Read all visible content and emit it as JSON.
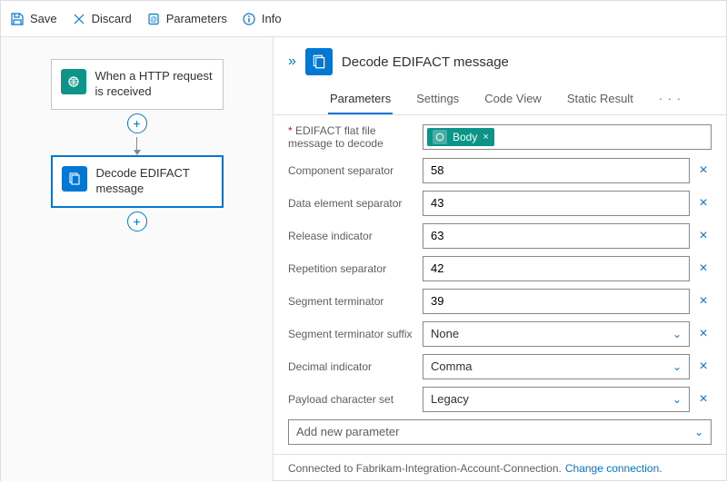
{
  "toolbar": {
    "save": "Save",
    "discard": "Discard",
    "parameters": "Parameters",
    "info": "Info"
  },
  "canvas": {
    "trigger": "When a HTTP request is received",
    "action": "Decode EDIFACT message"
  },
  "panel": {
    "title": "Decode EDIFACT message",
    "tabs": {
      "parameters": "Parameters",
      "settings": "Settings",
      "codeview": "Code View",
      "staticresult": "Static Result",
      "more": "· · ·"
    }
  },
  "form": {
    "flatfile_label": "EDIFACT flat file message to decode",
    "flatfile_token": "Body",
    "component_sep_label": "Component separator",
    "component_sep_value": "58",
    "data_elem_sep_label": "Data element separator",
    "data_elem_sep_value": "43",
    "release_ind_label": "Release indicator",
    "release_ind_value": "63",
    "repetition_sep_label": "Repetition separator",
    "repetition_sep_value": "42",
    "segment_term_label": "Segment terminator",
    "segment_term_value": "39",
    "segment_term_suffix_label": "Segment terminator suffix",
    "segment_term_suffix_value": "None",
    "decimal_ind_label": "Decimal indicator",
    "decimal_ind_value": "Comma",
    "payload_charset_label": "Payload character set",
    "payload_charset_value": "Legacy",
    "add_new_param": "Add new parameter"
  },
  "footer": {
    "connected_to": "Connected to Fabrikam-Integration-Account-Connection.",
    "change": "Change connection."
  }
}
